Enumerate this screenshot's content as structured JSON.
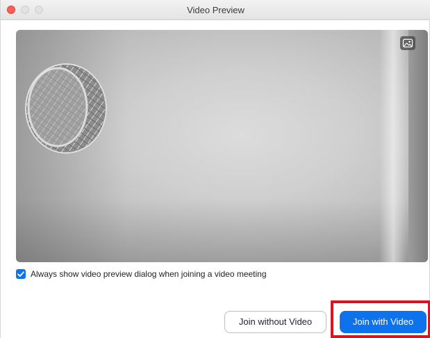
{
  "window": {
    "title": "Video Preview"
  },
  "preview": {
    "background_toggle_icon": "background-image-icon"
  },
  "options": {
    "always_show_label": "Always show video preview dialog when joining a video meeting",
    "always_show_checked": true
  },
  "footer": {
    "join_without_video_label": "Join without Video",
    "join_with_video_label": "Join with Video"
  },
  "colors": {
    "accent": "#0e72ed",
    "highlight": "#e0101e",
    "close": "#fe5f57"
  }
}
